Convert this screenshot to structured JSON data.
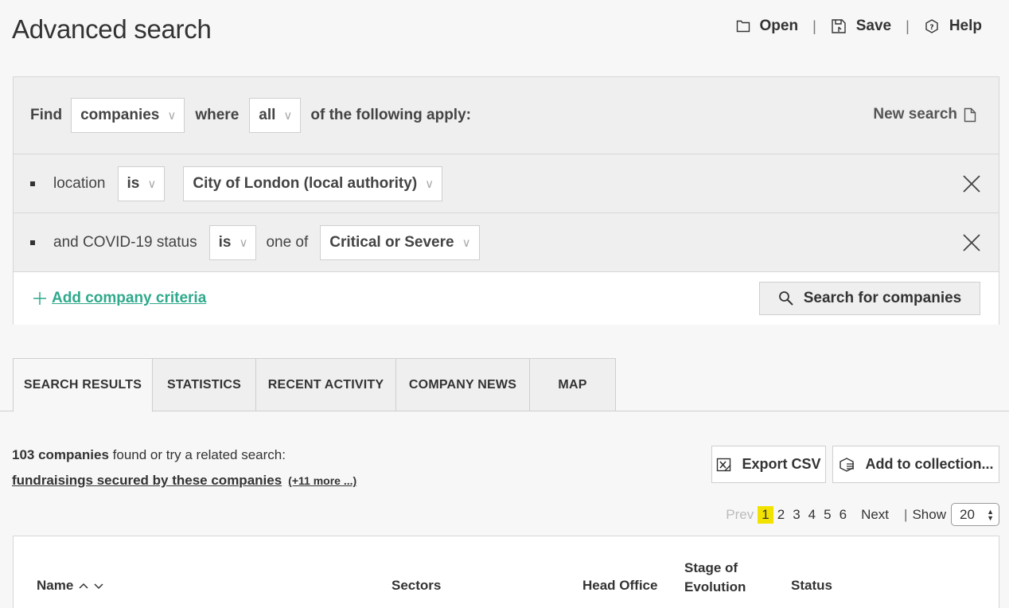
{
  "header": {
    "title": "Advanced search",
    "actions": {
      "open": "Open",
      "save": "Save",
      "help": "Help",
      "separator": "|"
    }
  },
  "query": {
    "find_label": "Find",
    "entity_value": "companies",
    "where_label": "where",
    "match_value": "all",
    "apply_label": "of the following apply:",
    "new_search_label": "New search"
  },
  "criteria": [
    {
      "field": "location",
      "operator": "is",
      "qualifier": "",
      "value": "City of London (local authority)"
    },
    {
      "field": "and COVID-19 status",
      "operator": "is",
      "qualifier": "one of",
      "value": "Critical or Severe"
    }
  ],
  "add_criteria_label": "Add company criteria",
  "search_button_label": "Search for companies",
  "tabs": [
    {
      "label": "SEARCH RESULTS",
      "active": true
    },
    {
      "label": "STATISTICS",
      "active": false
    },
    {
      "label": "RECENT ACTIVITY",
      "active": false
    },
    {
      "label": "COMPANY NEWS",
      "active": false
    },
    {
      "label": "MAP",
      "active": false
    }
  ],
  "results": {
    "count_text": "103 companies",
    "found_suffix": "found or try a related search:",
    "related_link": "fundraisings secured by these companies",
    "more_link": "(+11 more ...)",
    "export_label": "Export CSV",
    "collection_label": "Add to collection..."
  },
  "pagination": {
    "prev": "Prev",
    "pages": [
      "1",
      "2",
      "3",
      "4",
      "5",
      "6"
    ],
    "current": "1",
    "next": "Next",
    "separator": "|",
    "show_label": "Show",
    "show_value": "20"
  },
  "table": {
    "columns": {
      "name": "Name",
      "sectors": "Sectors",
      "head_office": "Head Office",
      "stage_line1": "Stage of",
      "stage_line2": "Evolution",
      "status": "Status"
    }
  },
  "colors": {
    "accent_green": "#2fa98c",
    "current_page": "#f2e200"
  }
}
